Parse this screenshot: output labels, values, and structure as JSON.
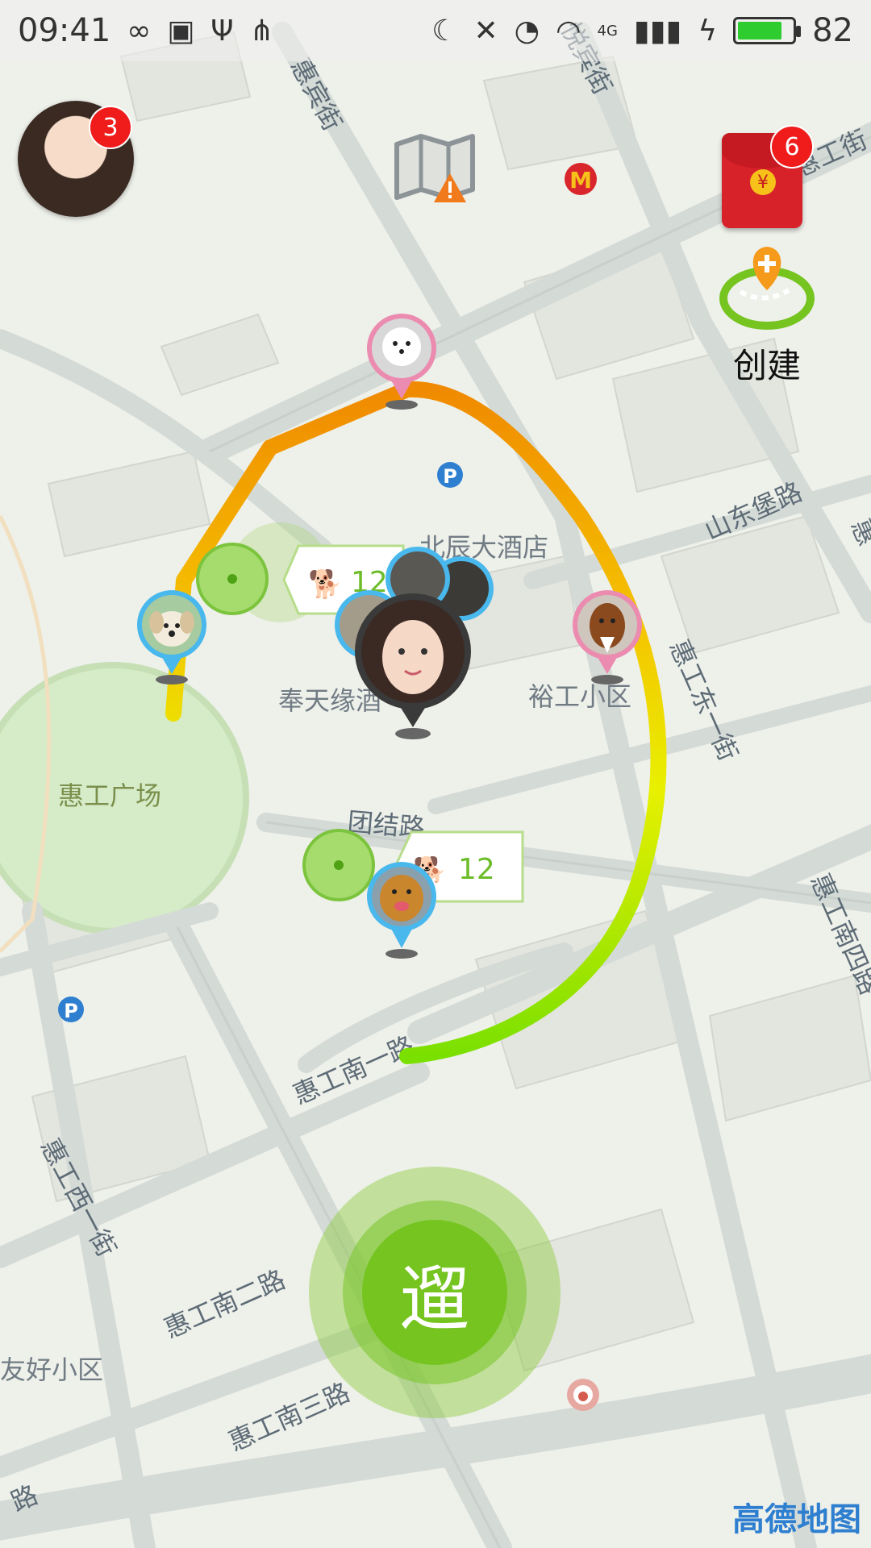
{
  "status_bar": {
    "time": "09:41",
    "network": "4G",
    "battery_level": "82",
    "battery_fraction": 0.82,
    "icons": [
      "infinity-icon",
      "image-icon",
      "usb-icon",
      "share-icon",
      "moon-icon",
      "mute-icon",
      "alarm-icon",
      "wifi-icon",
      "signal-icon",
      "charging-icon"
    ]
  },
  "profile": {
    "notification_count": "3",
    "icon": "user-avatar"
  },
  "red_packet": {
    "count": "6",
    "coin_symbol": "¥",
    "icon": "red-envelope-icon"
  },
  "create": {
    "label": "创建",
    "icon": "route-plus-icon"
  },
  "walk_button": {
    "label": "遛"
  },
  "map": {
    "provider": "高德地图",
    "streets": [
      "惠宾街",
      "悦宾街",
      "惠工街",
      "山东堡路",
      "惠工东一街",
      "团结路",
      "惠工南一路",
      "惠工南二路",
      "惠工南三路",
      "惠工西一街",
      "惠工南四路",
      "路",
      "惠"
    ],
    "places": [
      "北辰大酒店",
      "奉天缘酒",
      "裕工小区",
      "惠工广场",
      "友好小区"
    ],
    "poi_icons": [
      "mcdonalds-icon",
      "parking-icon",
      "parking-icon",
      "fire-station-icon"
    ]
  },
  "walk_groups": [
    {
      "count": "12",
      "icon": "dog-walk-icon"
    },
    {
      "count": "12",
      "icon": "dog-walk-icon"
    }
  ],
  "route_colors": {
    "start": "#f08a00",
    "middle": "#f5c400",
    "end": "#7ae000"
  },
  "accent": "#75c41f"
}
